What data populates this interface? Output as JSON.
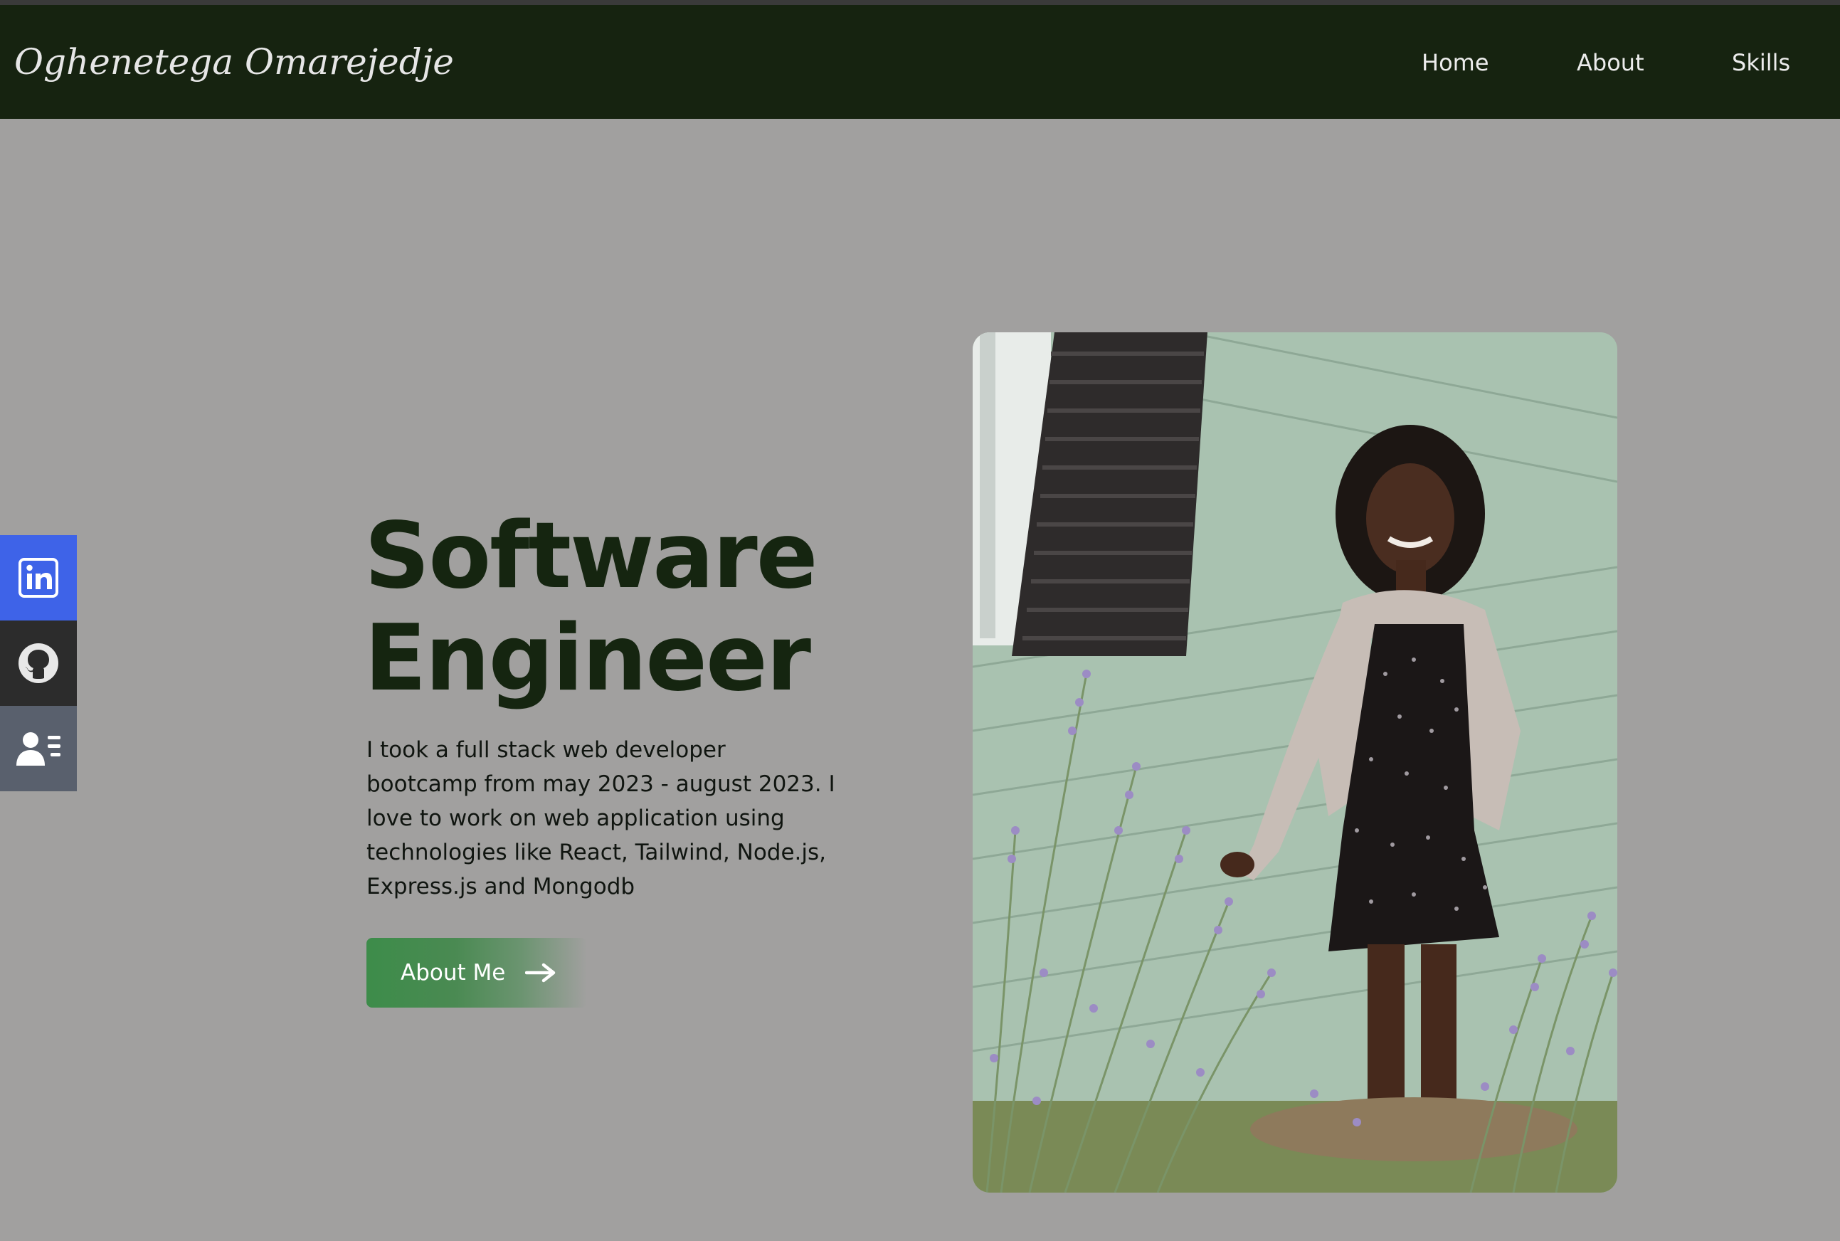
{
  "header": {
    "brand": "Oghenetega Omarejedje",
    "nav": [
      {
        "label": "Home"
      },
      {
        "label": "About"
      },
      {
        "label": "Skills"
      }
    ]
  },
  "social": [
    {
      "icon": "linkedin-icon"
    },
    {
      "icon": "github-icon"
    },
    {
      "icon": "resume-icon"
    }
  ],
  "hero": {
    "title_line1": "Software",
    "title_line2": "Engineer",
    "description": "I took a full stack web developer bootcamp from may 2023 - august 2023. I love to work on web application using technologies like React, Tailwind, Node.js, Express.js and Mongodb",
    "button_label": "About Me",
    "button_icon": "arrow-right-icon"
  },
  "colors": {
    "navbar_bg": "#162310",
    "page_bg": "#a1a09f",
    "title": "#152510",
    "linkedin": "#3e63e8",
    "github": "#2c2c2c",
    "resume": "#59606d",
    "button": "#3d8c4a"
  }
}
